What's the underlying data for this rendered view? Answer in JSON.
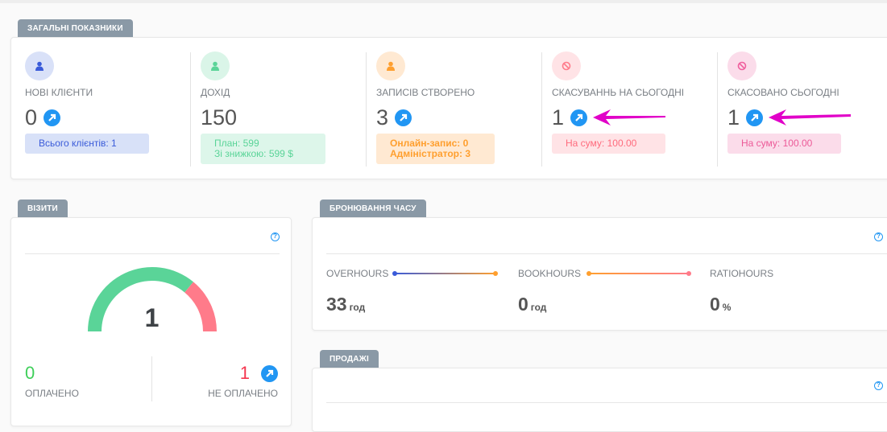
{
  "overview": {
    "tab": "ЗАГАЛЬНІ ПОКАЗНИКИ",
    "cards": [
      {
        "label": "НОВІ КЛІЄНТИ",
        "value": "0",
        "badge_lines": [
          "Всього клієнтів: 1"
        ],
        "icon": "user-icon"
      },
      {
        "label": "ДОХІД",
        "value": "150",
        "badge_lines": [
          "План: 599",
          "Зі знижкою: 599 $"
        ],
        "icon": "user-icon"
      },
      {
        "label": "ЗАПИСІВ СТВОРЕНО",
        "value": "3",
        "badge_lines": [
          "Онлайн-запис: 0",
          "Адміністратор: 3"
        ],
        "icon": "user-icon"
      },
      {
        "label": "СКАСУВАННЬ НА СЬОГОДНІ",
        "value": "1",
        "badge_lines": [
          "На суму: 100.00"
        ],
        "icon": "ban-icon"
      },
      {
        "label": "СКАСОВАНО СЬОГОДНІ",
        "value": "1",
        "badge_lines": [
          "На суму: 100.00"
        ],
        "icon": "ban-icon"
      }
    ]
  },
  "visits": {
    "tab": "ВІЗИТИ",
    "gauge_value": "1",
    "gauge_paid_fraction": 0.72,
    "paid_value": "0",
    "paid_label": "ОПЛАЧЕНО",
    "unpaid_value": "1",
    "unpaid_label": "НЕ ОПЛАЧЕНО"
  },
  "booking": {
    "tab": "БРОНЮВАННЯ ЧАСУ",
    "metrics": [
      {
        "label": "OVERHOURS",
        "value": "33",
        "unit": "год"
      },
      {
        "label": "BOOKHOURS",
        "value": "0",
        "unit": "год"
      },
      {
        "label": "RATIOHOURS",
        "value": "0",
        "unit": "%"
      }
    ]
  },
  "sales": {
    "tab": "ПРОДАЖІ"
  },
  "help_glyph": "?",
  "colors": {
    "accent": "#2196f3",
    "green": "#5ad498",
    "red": "#ff7b8a",
    "annotation": "#e100c8"
  }
}
